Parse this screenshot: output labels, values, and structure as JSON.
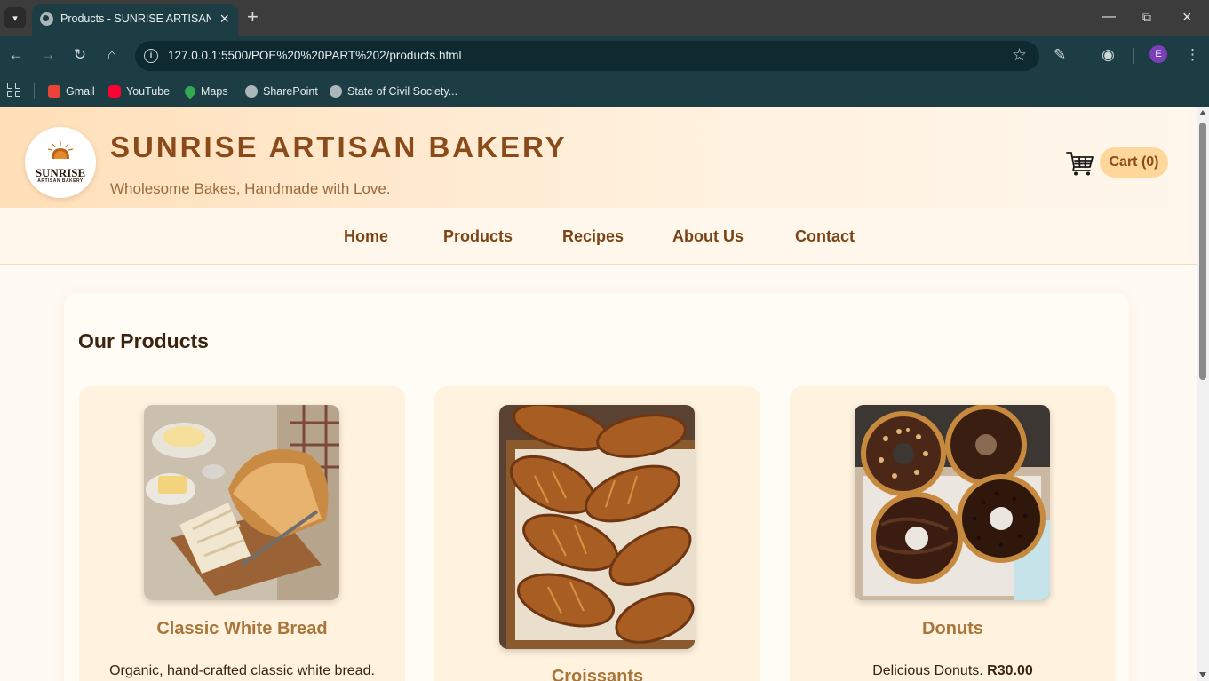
{
  "browser": {
    "tab_title": "Products - SUNRISE ARTISAN BAKERY",
    "url": "127.0.0.1:5500/POE%20%20PART%202/products.html",
    "profile_initial": "E",
    "bookmarks": [
      {
        "label": "Gmail",
        "icon": "gmail-icon",
        "color": "#ea4335"
      },
      {
        "label": "YouTube",
        "icon": "youtube-icon",
        "color": "#ff0033"
      },
      {
        "label": "Maps",
        "icon": "maps-icon",
        "color": "#34a853"
      },
      {
        "label": "SharePoint",
        "icon": "globe-icon",
        "color": "#aab6b9"
      },
      {
        "label": "State of Civil Society...",
        "icon": "globe-icon",
        "color": "#aab6b9"
      }
    ]
  },
  "site": {
    "logo_word": "SUNRISE",
    "logo_sub": "ARTISAN BAKERY",
    "title": "SUNRISE ARTISAN BAKERY",
    "tagline": "Wholesome Bakes, Handmade with Love.",
    "cart_label": "Cart (0)"
  },
  "nav": {
    "items": [
      "Home",
      "Products",
      "Recipes",
      "About Us",
      "Contact"
    ]
  },
  "products": {
    "heading": "Our Products",
    "items": [
      {
        "name": "Classic White Bread",
        "description": "Organic, hand-crafted classic white bread.",
        "price": ""
      },
      {
        "name": "Croissants",
        "description": "",
        "price": ""
      },
      {
        "name": "Donuts",
        "description": "Delicious Donuts.",
        "price": "R30.00"
      }
    ]
  },
  "colors": {
    "brand": "#8a4a1a",
    "accent": "#ffd79a",
    "card_bg": "#fff3df",
    "browser_frame": "#1d3d44"
  }
}
